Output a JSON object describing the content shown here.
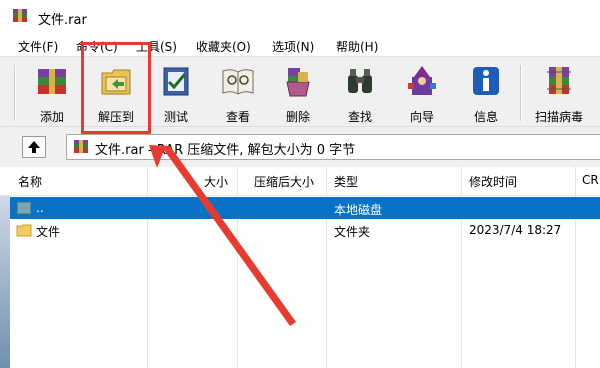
{
  "window": {
    "title": "文件.rar"
  },
  "menu": [
    "文件(F)",
    "命令(C)",
    "工具(S)",
    "收藏夹(O)",
    "选项(N)",
    "帮助(H)"
  ],
  "toolbar": {
    "add": "添加",
    "extract_to": "解压到",
    "test": "测试",
    "view": "查看",
    "delete": "删除",
    "find": "查找",
    "wizard": "向导",
    "info": "信息",
    "virus_scan": "扫描病毒"
  },
  "address": {
    "path": "文件.rar - RAR 压缩文件, 解包大小为 0 字节"
  },
  "columns": [
    "名称",
    "大小",
    "压缩后大小",
    "类型",
    "修改时间",
    "CR"
  ],
  "rows": [
    {
      "name": "..",
      "type": "本地磁盘",
      "modified": "",
      "selected": true
    },
    {
      "name": "文件",
      "type": "文件夹",
      "modified": "2023/7/4 18:27",
      "selected": false
    }
  ],
  "colors": {
    "selection": "#0a72c6",
    "annotation": "#e83b2f",
    "toolbar_bg": "#f0f0f0"
  },
  "icons": [
    "winrar-icon",
    "add-icon",
    "extract-icon",
    "test-icon",
    "view-icon",
    "delete-icon",
    "find-icon",
    "wizard-icon",
    "info-icon",
    "virus-scan-icon",
    "up-folder-icon",
    "folder-icon"
  ]
}
